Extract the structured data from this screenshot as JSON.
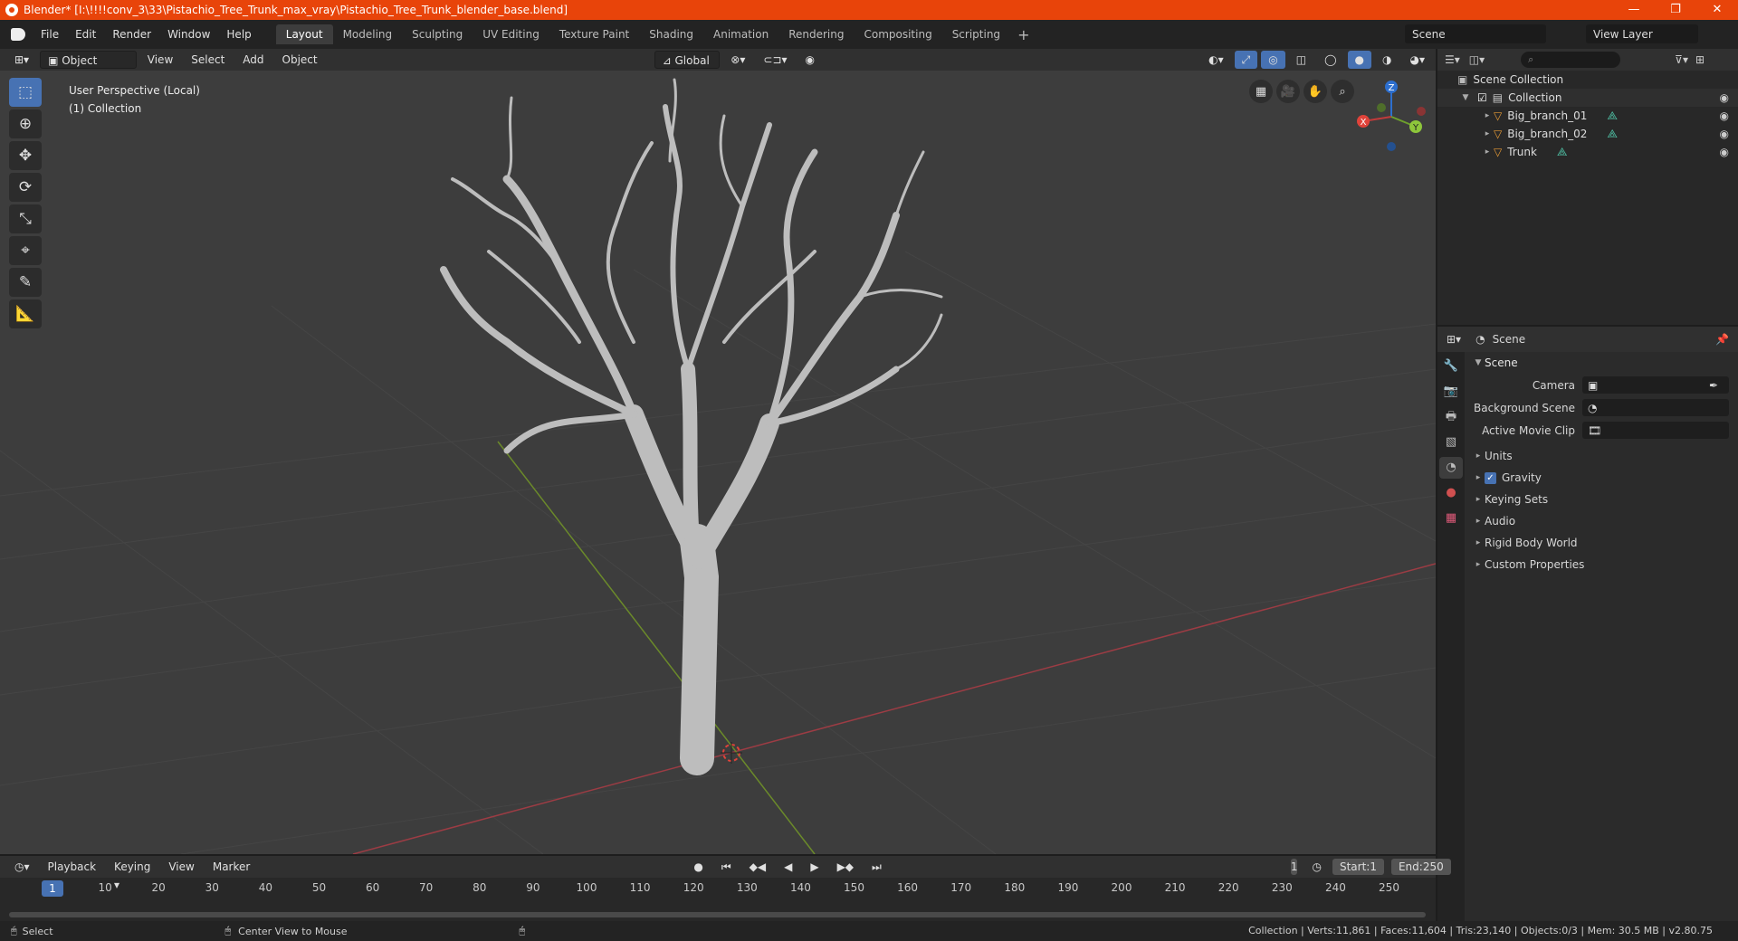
{
  "titlebar": {
    "title": "Blender* [I:\\!!!!conv_3\\33\\Pistachio_Tree_Trunk_max_vray\\Pistachio_Tree_Trunk_blender_base.blend]",
    "minimize": "—",
    "maximize": "❐",
    "close": "✕"
  },
  "menu": {
    "items": [
      "File",
      "Edit",
      "Render",
      "Window",
      "Help"
    ]
  },
  "workspaces": {
    "tabs": [
      "Layout",
      "Modeling",
      "Sculpting",
      "UV Editing",
      "Texture Paint",
      "Shading",
      "Animation",
      "Rendering",
      "Compositing",
      "Scripting"
    ],
    "active": "Layout",
    "add": "+"
  },
  "scene": {
    "name": "Scene",
    "view_layer": "View Layer"
  },
  "viewport_header": {
    "mode": "Object Mode",
    "menus": [
      "View",
      "Select",
      "Add",
      "Object"
    ],
    "orientation": "Global"
  },
  "viewport": {
    "perspective": "User Perspective (Local)",
    "collection": "(1) Collection"
  },
  "gizmo": {
    "x": "X",
    "y": "Y",
    "z": "Z"
  },
  "outliner": {
    "search_placeholder": "⌕",
    "root": "Scene Collection",
    "collection": "Collection",
    "objects": [
      {
        "name": "Big_branch_01"
      },
      {
        "name": "Big_branch_02"
      },
      {
        "name": "Trunk"
      }
    ]
  },
  "properties": {
    "header": "Scene",
    "panel": "Scene",
    "camera_label": "Camera",
    "background_label": "Background Scene",
    "movie_label": "Active Movie Clip",
    "subpanels": [
      "Units",
      "Gravity",
      "Keying Sets",
      "Audio",
      "Rigid Body World",
      "Custom Properties"
    ],
    "gravity_checked": true
  },
  "timeline": {
    "menus": [
      "Playback",
      "Keying",
      "View",
      "Marker"
    ],
    "current_frame": "1",
    "start_label": "Start:",
    "start": "1",
    "end_label": "End:",
    "end": "250",
    "ticks": [
      "10",
      "20",
      "30",
      "40",
      "50",
      "60",
      "70",
      "80",
      "90",
      "100",
      "110",
      "120",
      "130",
      "140",
      "150",
      "160",
      "170",
      "180",
      "190",
      "200",
      "210",
      "220",
      "230",
      "240",
      "250"
    ],
    "marker": "1"
  },
  "status": {
    "left1": "Select",
    "left2": "Center View to Mouse",
    "right": "Collection | Verts:11,861 | Faces:11,604 | Tris:23,140 | Objects:0/3 | Mem: 30.5 MB | v2.80.75"
  }
}
